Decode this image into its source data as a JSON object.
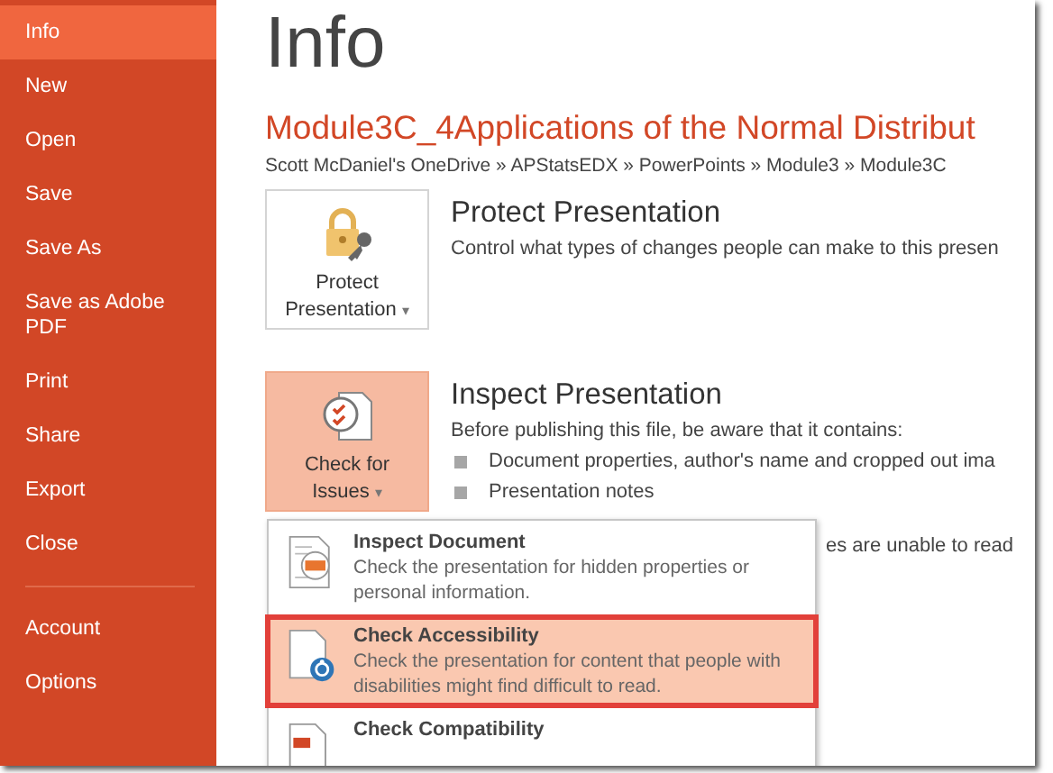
{
  "sidebar": {
    "items": [
      {
        "label": "Info",
        "selected": true
      },
      {
        "label": "New",
        "selected": false
      },
      {
        "label": "Open",
        "selected": false
      },
      {
        "label": "Save",
        "selected": false
      },
      {
        "label": "Save As",
        "selected": false
      },
      {
        "label": "Save as Adobe PDF",
        "selected": false
      },
      {
        "label": "Print",
        "selected": false
      },
      {
        "label": "Share",
        "selected": false
      },
      {
        "label": "Export",
        "selected": false
      },
      {
        "label": "Close",
        "selected": false
      }
    ],
    "footer_items": [
      {
        "label": "Account",
        "selected": false
      },
      {
        "label": "Options",
        "selected": false
      }
    ]
  },
  "page_title": "Info",
  "document_title": "Module3C_4Applications of the Normal Distribut",
  "breadcrumb": "Scott McDaniel's OneDrive » APStatsEDX » PowerPoints » Module3 » Module3C",
  "sections": [
    {
      "kind": "protect",
      "button": {
        "line_1": "Protect",
        "line_2": "Presentation",
        "caret": "▾",
        "selected": false
      },
      "heading": "Protect Presentation",
      "description": "Control what types of changes people can make to this presen"
    },
    {
      "kind": "inspect",
      "button": {
        "line_1": "Check for",
        "line_2": "Issues",
        "caret": "▾",
        "selected": true
      },
      "heading": "Inspect Presentation",
      "description": "Before publishing this file, be aware that it contains:",
      "bullets": [
        "Document properties, author's name and cropped out ima",
        "Presentation notes"
      ],
      "covered_text": "es are unable to read"
    }
  ],
  "menu": [
    {
      "kind": "inspect",
      "title": "Inspect Document",
      "description": "Check the presentation for hidden properties or personal information.",
      "selected": false
    },
    {
      "kind": "accessibility",
      "title": "Check Accessibility",
      "description": "Check the presentation for content that people with disabilities might find difficult to read.",
      "selected": true
    },
    {
      "kind": "compatibility",
      "title": "Check Compatibility",
      "selected": false
    }
  ]
}
